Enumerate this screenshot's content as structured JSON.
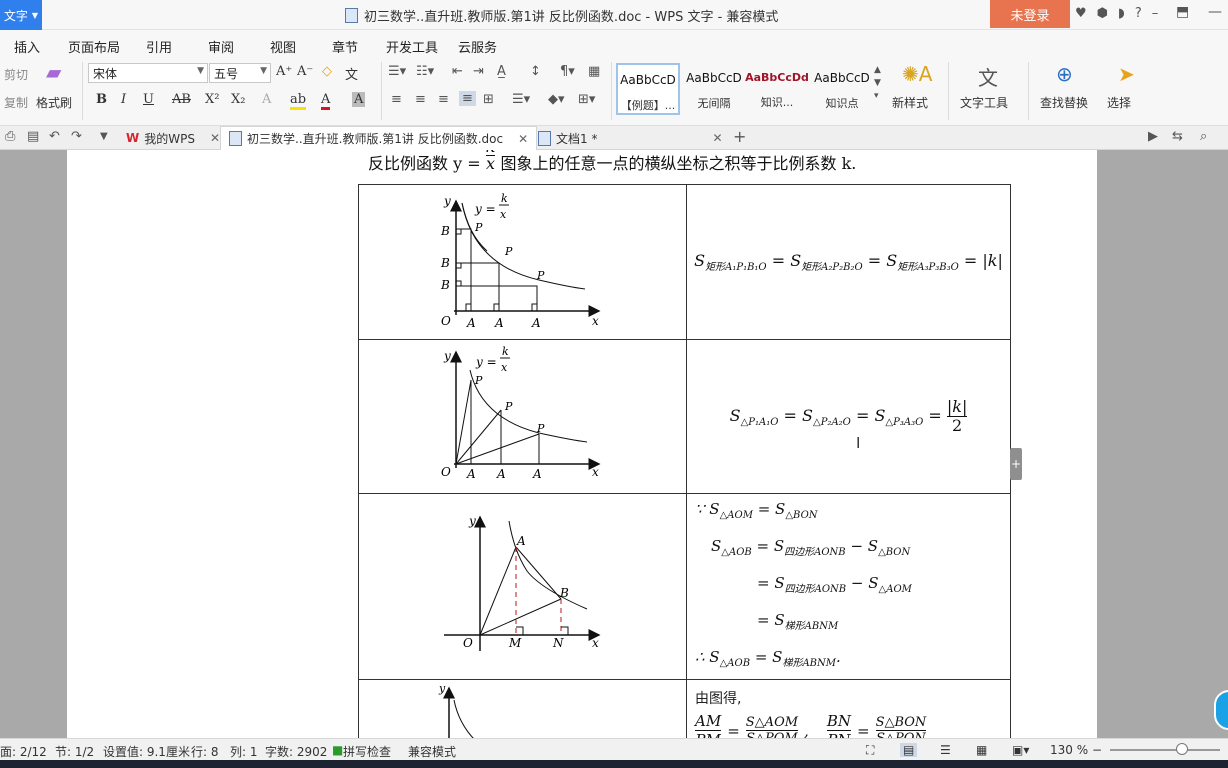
{
  "titlebar": {
    "app_label": "文字",
    "title": "初三数学..直升班.教师版.第1讲 反比例函数.doc - WPS 文字 - 兼容模式",
    "login": "未登录",
    "help": "?"
  },
  "menu": [
    "插入",
    "页面布局",
    "引用",
    "审阅",
    "视图",
    "章节",
    "开发工具",
    "云服务"
  ],
  "ribbon": {
    "cut": "剪切",
    "copy": "复制",
    "format_painter": "格式刷",
    "font_name": "宋体",
    "font_size": "五号",
    "styles": [
      {
        "sample": "AaBbCcD",
        "name": "【例题】..."
      },
      {
        "sample": "AaBbCcD",
        "name": "无间隔"
      },
      {
        "sample": "AaBbCcDd",
        "name": "知识..."
      },
      {
        "sample": "AaBbCcD",
        "name": "知识点"
      }
    ],
    "new_style": "新样式",
    "text_tools": "文字工具",
    "find_replace": "查找替换",
    "select": "选择"
  },
  "tabs": {
    "my_wps": "我的WPS",
    "doc": "初三数学..直升班.教师版.第1讲  反比例函数.doc",
    "doc1": "文档1 *"
  },
  "document": {
    "intro_prefix": "反比例函数 y = ",
    "intro_suffix": " 图象上的任意一点的横纵坐标之积等于比例系数 k."
  },
  "statusbar": {
    "page": "面: 2/12",
    "section": "节: 1/2",
    "setting": "设置值: 9.1厘米",
    "row": "行: 8",
    "col": "列: 1",
    "words": "字数: 2902",
    "spell": "拼写检查",
    "compat": "兼容模式",
    "zoom": "130 %"
  }
}
